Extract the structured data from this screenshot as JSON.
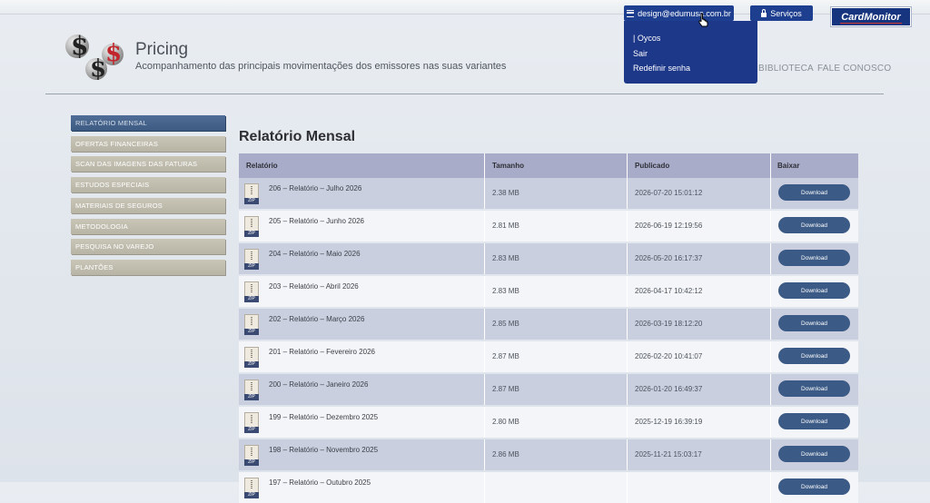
{
  "header": {
    "title": "Pricing",
    "subtitle": "Acompanhamento das principais movimentações dos emissores nas suas variantes",
    "nav": [
      "BIBLIOTECA",
      "FALE CONOSCO"
    ],
    "user_email": "design@edumusa.com.br",
    "services_label": "Serviços",
    "brand": "CardMonitor"
  },
  "user_menu": {
    "items": [
      "| Oycos",
      "Sair",
      "Redefinir senha"
    ]
  },
  "sidebar": {
    "items": [
      {
        "label": "RELATÓRIO MENSAL",
        "active": true
      },
      {
        "label": "OFERTAS FINANCEIRAS",
        "active": false
      },
      {
        "label": "SCAN DAS IMAGENS DAS FATURAS",
        "active": false
      },
      {
        "label": "ESTUDOS ESPECIAIS",
        "active": false
      },
      {
        "label": "MATERIAIS DE SEGUROS",
        "active": false
      },
      {
        "label": "METODOLOGIA",
        "active": false
      },
      {
        "label": "PESQUISA NO VAREJO",
        "active": false
      },
      {
        "label": "PLANTÕES",
        "active": false
      }
    ]
  },
  "main": {
    "title": "Relatório Mensal",
    "columns": [
      "Relatório",
      "Tamanho",
      "Publicado",
      "Baixar"
    ],
    "file_type": "ZIP",
    "download_label": "Download",
    "rows": [
      {
        "name": "206 – Relatório – Julho 2026",
        "size": "2.38 MB",
        "published": "2026-07-20 15:01:12"
      },
      {
        "name": "205 – Relatório – Junho 2026",
        "size": "2.81 MB",
        "published": "2026-06-19 12:19:56"
      },
      {
        "name": "204 – Relatório – Maio 2026",
        "size": "2.83 MB",
        "published": "2026-05-20 16:17:37"
      },
      {
        "name": "203 – Relatório – Abril 2026",
        "size": "2.83 MB",
        "published": "2026-04-17 10:42:12"
      },
      {
        "name": "202 – Relatório – Março 2026",
        "size": "2.85 MB",
        "published": "2026-03-19 18:12:20"
      },
      {
        "name": "201 – Relatório – Fevereiro 2026",
        "size": "2.87 MB",
        "published": "2026-02-20 10:41:07"
      },
      {
        "name": "200 – Relatório – Janeiro 2026",
        "size": "2.87 MB",
        "published": "2026-01-20 16:49:37"
      },
      {
        "name": "199 – Relatório – Dezembro 2025",
        "size": "2.80 MB",
        "published": "2025-12-19 16:39:19"
      },
      {
        "name": "198 – Relatório – Novembro 2025",
        "size": "2.86 MB",
        "published": "2025-11-21 15:03:17"
      },
      {
        "name": "197 – Relatório – Outubro 2025",
        "size": "",
        "published": ""
      }
    ]
  }
}
